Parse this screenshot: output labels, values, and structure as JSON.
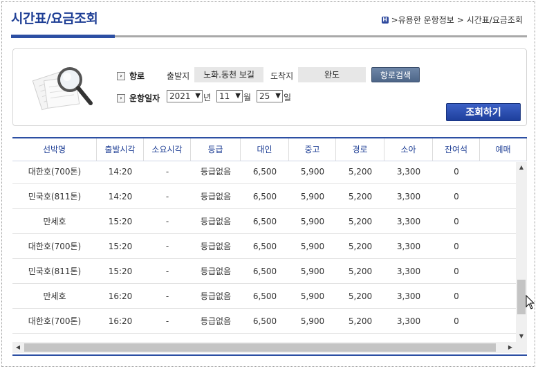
{
  "page": {
    "title": "시간표/요금조회",
    "breadcrumb": [
      ">유용한 운항정보",
      "> 시간표/요금조회"
    ],
    "breadcrumb_home_icon": "home-icon"
  },
  "search": {
    "route_label": "항로",
    "date_label": "운항일자",
    "departure_label": "출발지",
    "departure_value": "노화.동천 보길",
    "arrival_label": "도착지",
    "arrival_value": "완도",
    "route_search_button": "항로검색",
    "year_value": "2021",
    "year_unit": "년",
    "month_value": "11",
    "month_unit": "월",
    "day_value": "25",
    "day_unit": "일",
    "query_button": "조회하기"
  },
  "table": {
    "headers": [
      "선박명",
      "출발시각",
      "소요시각",
      "등급",
      "대인",
      "중고",
      "경로",
      "소아",
      "잔여석",
      "예매"
    ],
    "rows": [
      [
        "대한호(700톤)",
        "14:20",
        "-",
        "등급없음",
        "6,500",
        "5,900",
        "5,200",
        "3,300",
        "0",
        ""
      ],
      [
        "민국호(811톤)",
        "14:20",
        "-",
        "등급없음",
        "6,500",
        "5,900",
        "5,200",
        "3,300",
        "0",
        ""
      ],
      [
        "만세호",
        "15:20",
        "-",
        "등급없음",
        "6,500",
        "5,900",
        "5,200",
        "3,300",
        "0",
        ""
      ],
      [
        "대한호(700톤)",
        "15:20",
        "-",
        "등급없음",
        "6,500",
        "5,900",
        "5,200",
        "3,300",
        "0",
        ""
      ],
      [
        "민국호(811톤)",
        "15:20",
        "-",
        "등급없음",
        "6,500",
        "5,900",
        "5,200",
        "3,300",
        "0",
        ""
      ],
      [
        "만세호",
        "16:20",
        "-",
        "등급없음",
        "6,500",
        "5,900",
        "5,200",
        "3,300",
        "0",
        ""
      ],
      [
        "대한호(700톤)",
        "16:20",
        "-",
        "등급없음",
        "6,500",
        "5,900",
        "5,200",
        "3,300",
        "0",
        ""
      ],
      [
        "민국호(811톤)",
        "16:20",
        "-",
        "등급없음",
        "6,500",
        "5,900",
        "5,200",
        "3,300",
        "0",
        ""
      ]
    ]
  },
  "colors": {
    "brand_blue": "#1f3f95",
    "rule_blue": "#2c4fa3",
    "button_blue": "#2a4bb0",
    "route_button": "#5a7396"
  }
}
